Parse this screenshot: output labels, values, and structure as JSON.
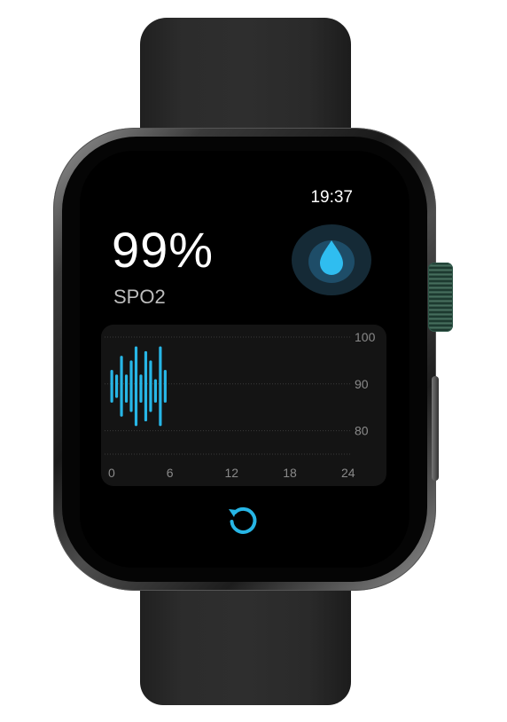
{
  "status": {
    "time": "19:37"
  },
  "metric": {
    "value": "99%",
    "label": "SPO2",
    "icon": "water-drop-icon"
  },
  "chart_data": {
    "type": "bar",
    "y_ticks": [
      "100",
      "90",
      "80"
    ],
    "x_ticks": [
      "0",
      "6",
      "12",
      "18",
      "24"
    ],
    "xlim": [
      0,
      24
    ],
    "ylim": [
      75,
      100
    ],
    "grid": true,
    "bar_color": "#27b6e6",
    "bars": [
      {
        "x": 0.0,
        "low": 86,
        "high": 93
      },
      {
        "x": 0.5,
        "low": 87,
        "high": 92
      },
      {
        "x": 1.0,
        "low": 83,
        "high": 96
      },
      {
        "x": 1.5,
        "low": 86,
        "high": 92
      },
      {
        "x": 2.0,
        "low": 84,
        "high": 95
      },
      {
        "x": 2.5,
        "low": 81,
        "high": 98
      },
      {
        "x": 3.0,
        "low": 86,
        "high": 92
      },
      {
        "x": 3.5,
        "low": 82,
        "high": 97
      },
      {
        "x": 4.0,
        "low": 84,
        "high": 95
      },
      {
        "x": 4.5,
        "low": 86,
        "high": 91
      },
      {
        "x": 5.0,
        "low": 81,
        "high": 98
      },
      {
        "x": 5.5,
        "low": 86,
        "high": 93
      }
    ]
  },
  "actions": {
    "refresh_icon": "refresh-icon"
  },
  "colors": {
    "accent": "#27b6e6",
    "badge_bg": "#152a36",
    "panel_bg": "#141414"
  }
}
